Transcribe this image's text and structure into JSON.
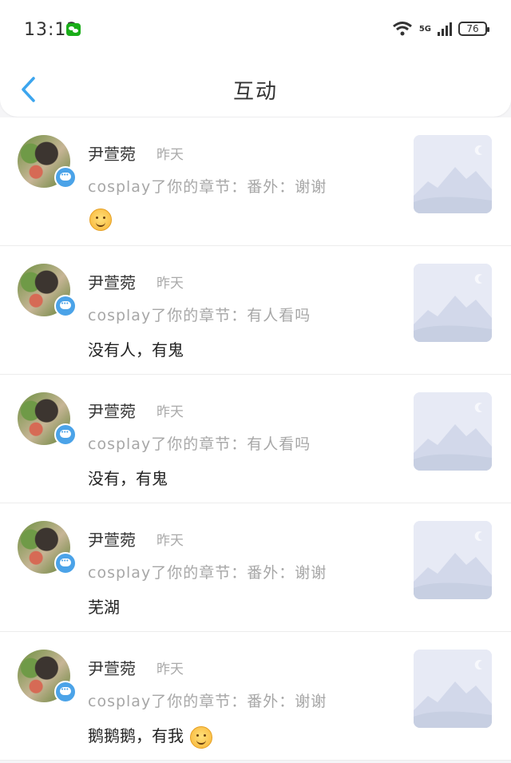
{
  "status_bar": {
    "time": "13:12",
    "network": "5G",
    "battery": "76"
  },
  "header": {
    "title": "互动"
  },
  "interactions": [
    {
      "name": "尹萱菀",
      "time": "昨天",
      "chapter": "cosplay了你的章节：番外：谢谢",
      "comment": "",
      "emoji": "smile-emoji"
    },
    {
      "name": "尹萱菀",
      "time": "昨天",
      "chapter": "cosplay了你的章节：有人看吗",
      "comment": "没有人，有鬼",
      "emoji": ""
    },
    {
      "name": "尹萱菀",
      "time": "昨天",
      "chapter": "cosplay了你的章节：有人看吗",
      "comment": "没有，有鬼",
      "emoji": ""
    },
    {
      "name": "尹萱菀",
      "time": "昨天",
      "chapter": "cosplay了你的章节：番外：谢谢",
      "comment": "芜湖",
      "emoji": ""
    },
    {
      "name": "尹萱菀",
      "time": "昨天",
      "chapter": "cosplay了你的章节：番外：谢谢",
      "comment": "鹅鹅鹅，有我",
      "emoji": "wink-emoji"
    }
  ],
  "colors": {
    "accent": "#4ba3e8",
    "muted_text": "#a7a7a7"
  }
}
